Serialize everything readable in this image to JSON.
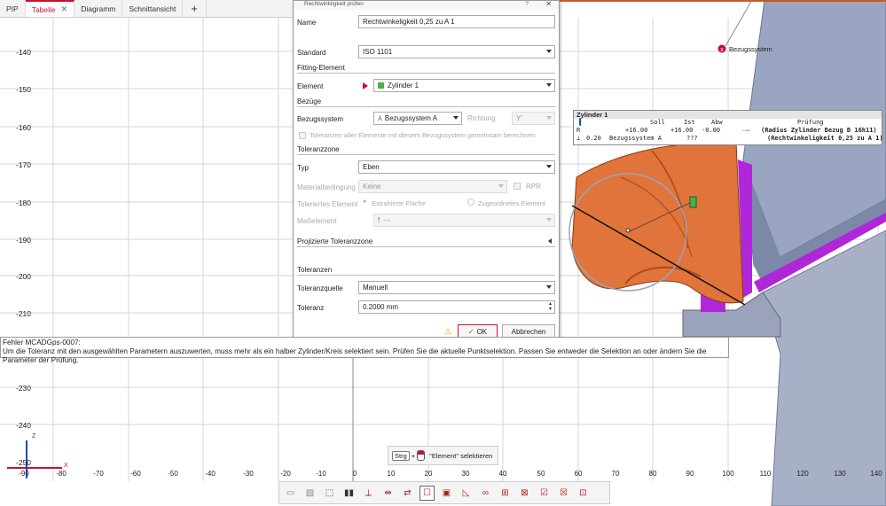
{
  "tabs": [
    {
      "label": "PIP"
    },
    {
      "label": "Tabelle",
      "active": true
    },
    {
      "label": "Diagramm"
    },
    {
      "label": "Schnittansicht"
    }
  ],
  "tab_add": "+",
  "y_axis": [
    "-140",
    "-150",
    "-160",
    "-170",
    "-180",
    "-190",
    "-200",
    "-210",
    "-230",
    "-240",
    "-250"
  ],
  "x_axis": [
    "-90",
    "-80",
    "-70",
    "-60",
    "-50",
    "-40",
    "-30",
    "-20",
    "-10",
    "0",
    "10",
    "20",
    "30",
    "40",
    "50",
    "60",
    "70",
    "80",
    "90",
    "100",
    "110",
    "120",
    "130",
    "140"
  ],
  "axis_labels": {
    "z": "Z",
    "x": "X"
  },
  "dialog": {
    "title": "Rechtwinkligkeit prüfen",
    "help": "?",
    "name_label": "Name",
    "name_value": "Rechtwinkeligkeit 0,25 zu A 1",
    "standard_label": "Standard",
    "standard_value": "ISO 1101",
    "section_fitting": "Fitting-Element",
    "element_label": "Element",
    "element_value": "Zylinder 1",
    "section_bezuege": "Bezüge",
    "bezugssystem_label": "Bezugssystem",
    "bezugssystem_value": "Bezugssystem A",
    "richtung_label": "Richtung",
    "richtung_value": "Y'",
    "tol_all": "Toleranzen aller Elemente mit diesem Bezugssystem gemeinsam berechnen",
    "section_zone": "Toleranzzone",
    "typ_label": "Typ",
    "typ_value": "Eben",
    "material_label": "Materialbedingung",
    "material_value": "Keine",
    "rpr": "RPR",
    "toleriertes_label": "Toleriertes Element",
    "extrahiert": "Extrahierte Fläche",
    "zugeordnet": "Zugeordnetes Element",
    "masselement_label": "Maßelement",
    "masselement_value": "---",
    "section_projiziert": "Projizierte Toleranzzone",
    "section_toleranzen": "Toleranzen",
    "quelle_label": "Toleranzquelle",
    "quelle_value": "Manuell",
    "toleranz_label": "Toleranz",
    "toleranz_value": "0.2000 mm",
    "ok": "OK",
    "cancel": "Abbrechen"
  },
  "bezugssystem_tag": "Bezugssystem",
  "table": {
    "title": "Zylinder 1",
    "headers": [
      "Soll",
      "Ist",
      "Abw",
      "Prüfung"
    ],
    "row1": {
      "id": "R",
      "soll": "+16.00",
      "ist": "+16.00",
      "abw": "-0.00",
      "pruefung": "(Radius Zylinder Bezug B 16h11)"
    },
    "row2": {
      "tol": "0.20",
      "ref": "Bezugssystem A",
      "ist": "???",
      "pruefung": "(Rechtwinkeligkeit 0,25 zu A 1)"
    }
  },
  "error": {
    "line1": "Fehler MCADGps-0007:",
    "line2": "Um die Toleranz mit den ausgewählten Parametern auszuwerten, muss mehr als ein halber Zylinder/Kreis selektiert sein. Prüfen Sie die aktuelle Punktselektion. Passen Sie entweder die Selektion an oder ändern Sie die Parameter der Prüfung."
  },
  "hint": {
    "key": "Strg",
    "plus": "+",
    "text": "\"Element\" selektieren"
  },
  "colors": {
    "accent": "#c8102e",
    "part": "#e0743a",
    "purple": "#b026d9",
    "blue_gray": "#8a96b4"
  }
}
